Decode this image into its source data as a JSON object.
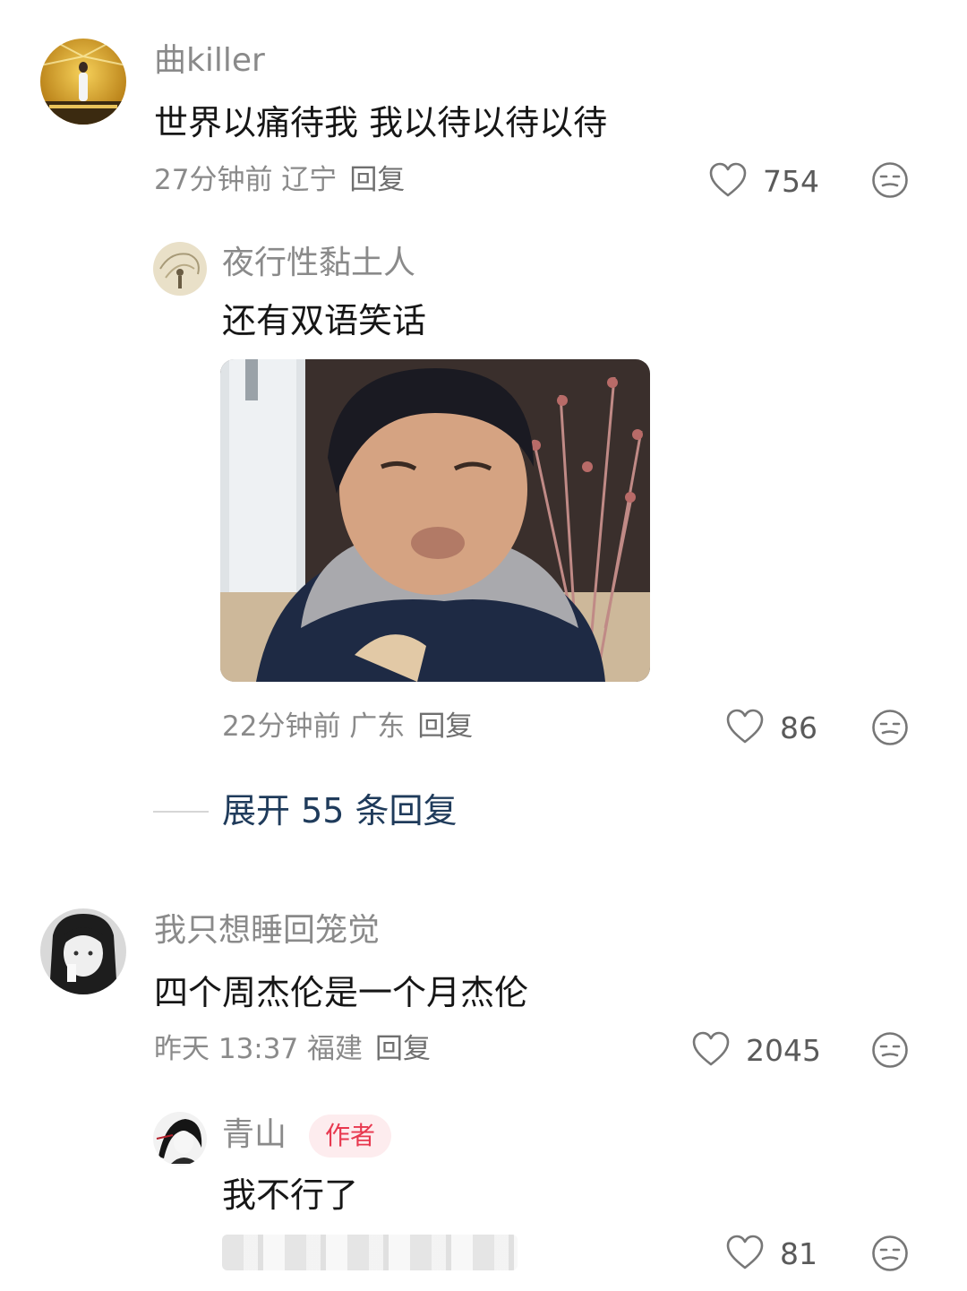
{
  "comments": [
    {
      "username": "曲killer",
      "text": "世界以痛待我 我以待以待以待",
      "meta": "27分钟前 辽宁",
      "reply_label": "回复",
      "likes": "754",
      "replies": [
        {
          "username": "夜行性黏土人",
          "text": "还有双语笑话",
          "meta": "22分钟前 广东",
          "reply_label": "回复",
          "likes": "86"
        }
      ],
      "expand_label": "展开 55 条回复"
    },
    {
      "username": "我只想睡回笼觉",
      "text": "四个周杰伦是一个月杰伦",
      "meta": "昨天 13:37 福建",
      "reply_label": "回复",
      "likes": "2045",
      "replies": [
        {
          "username": "青山",
          "badge": "作者",
          "text": "我不行了",
          "likes": "81"
        }
      ]
    }
  ],
  "colors": {
    "accent_badge": "#e8384f",
    "expand_link": "#1f3b5b"
  },
  "icons": [
    "heart-outline-icon",
    "meh-face-icon"
  ]
}
